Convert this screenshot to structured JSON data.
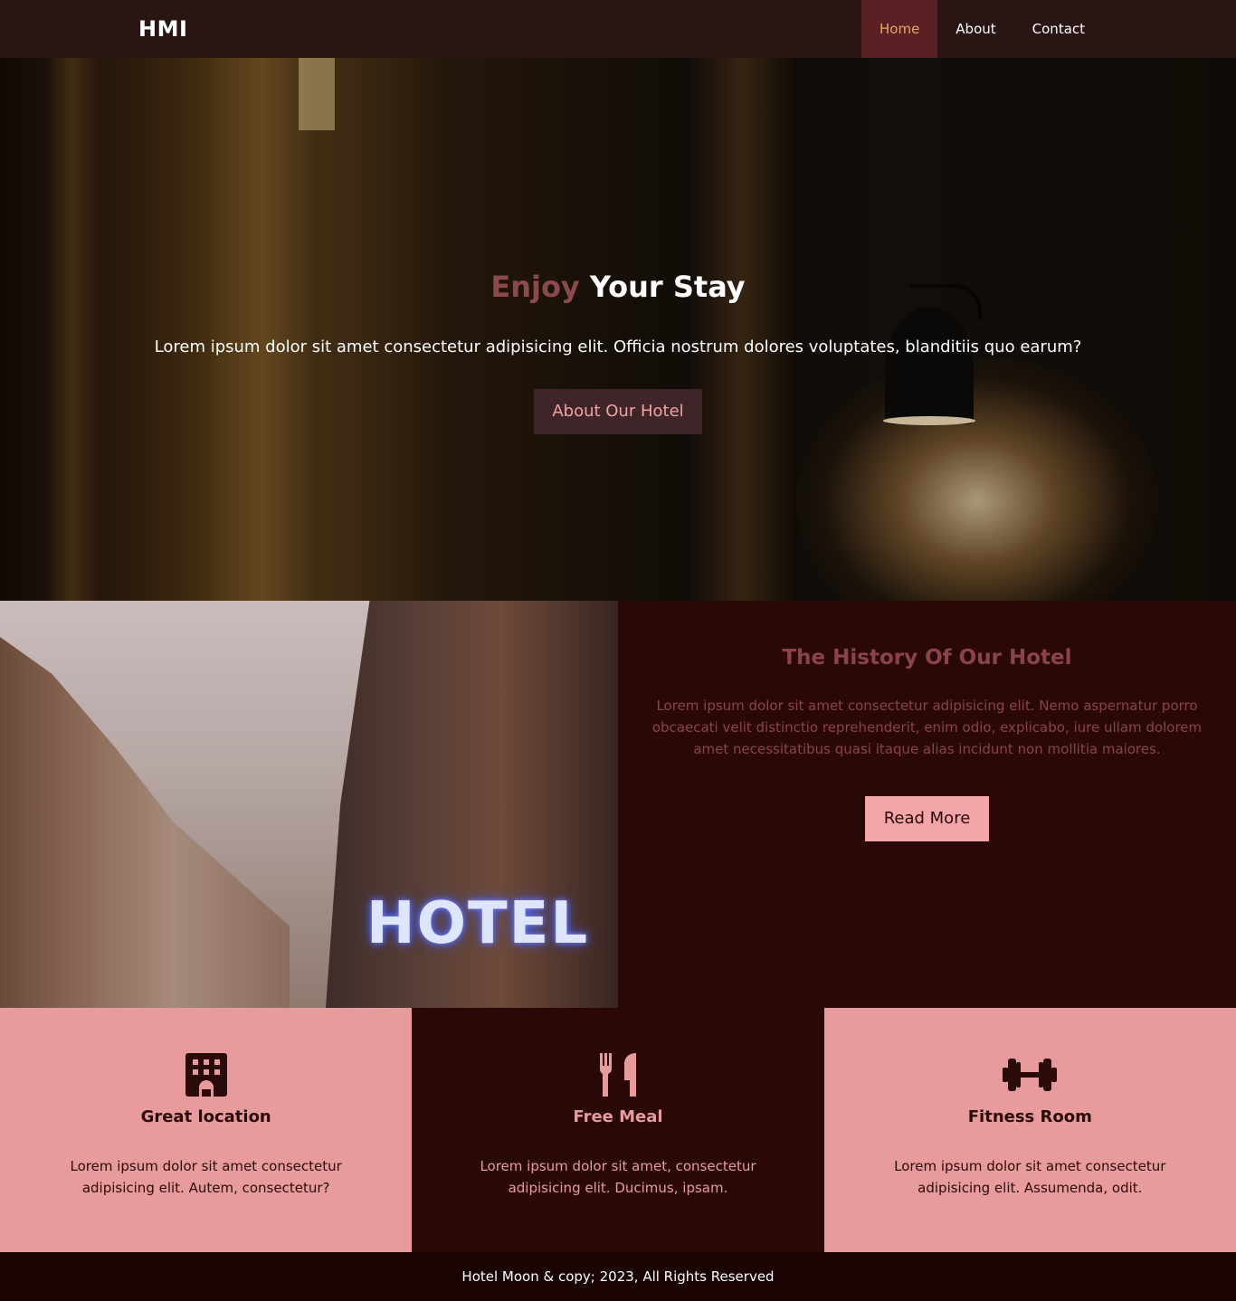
{
  "navbar": {
    "brand": "HMI",
    "items": [
      {
        "label": "Home",
        "active": true
      },
      {
        "label": "About",
        "active": false
      },
      {
        "label": "Contact",
        "active": false
      }
    ]
  },
  "hero": {
    "title_accent": "Enjoy",
    "title_main": "Your Stay",
    "text": "Lorem ipsum dolor sit amet consectetur adipisicing elit. Officia nostrum dolores voluptates, blanditiis quo earum?",
    "button_label": "About Our Hotel"
  },
  "history": {
    "sign_text": "HOTEL",
    "title": "The History Of Our Hotel",
    "text": "Lorem ipsum dolor sit amet consectetur adipisicing elit. Nemo aspernatur porro obcaecati velit distinctio reprehenderit, enim odio, explicabo, iure ullam dolorem amet necessitatibus quasi itaque alias incidunt non mollitia maiores.",
    "button_label": "Read More"
  },
  "features": [
    {
      "icon": "building-icon",
      "title": "Great location",
      "text": "Lorem ipsum dolor sit amet consectetur adipisicing elit. Autem, consectetur?"
    },
    {
      "icon": "utensils-icon",
      "title": "Free Meal",
      "text": "Lorem ipsum dolor sit amet, consectetur adipisicing elit. Ducimus, ipsam."
    },
    {
      "icon": "dumbbell-icon",
      "title": "Fitness Room",
      "text": "Lorem ipsum dolor sit amet consectetur adipisicing elit. Assumenda, odit."
    }
  ],
  "footer": {
    "text": "Hotel Moon & copy; 2023, All Rights Reserved"
  },
  "colors": {
    "navbar_bg": "#2a1515",
    "nav_active_bg": "#5a2023",
    "nav_active_text": "#e7a86a",
    "accent_dark": "#2b0808",
    "accent_pink": "#e89b9c",
    "button_pink": "#f3a5a8"
  }
}
